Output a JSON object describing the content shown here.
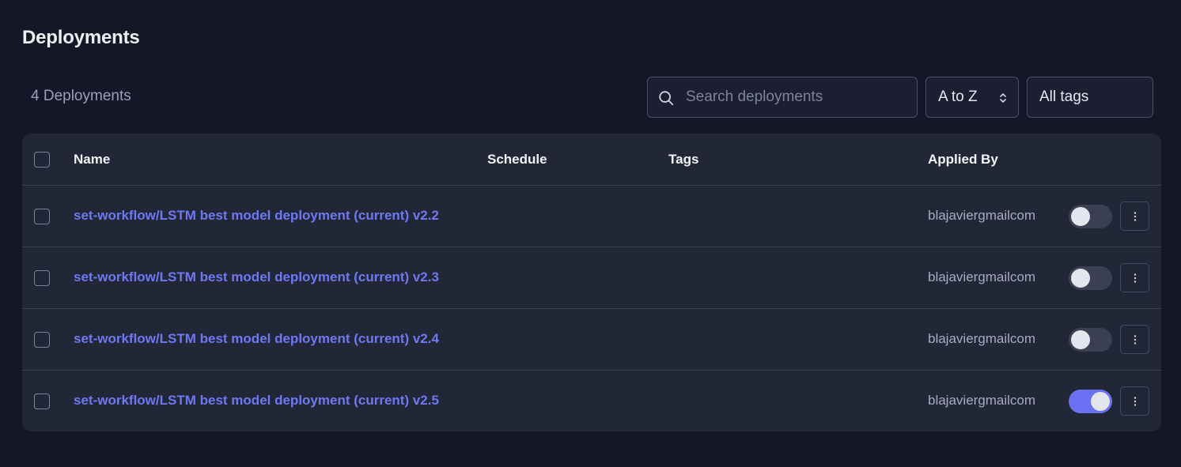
{
  "page": {
    "title": "Deployments",
    "count_label": "4 Deployments"
  },
  "toolbar": {
    "search_placeholder": "Search deployments",
    "sort_label": "A to Z",
    "tags_label": "All tags"
  },
  "table": {
    "columns": {
      "name": "Name",
      "schedule": "Schedule",
      "tags": "Tags",
      "applied_by": "Applied By"
    },
    "rows": [
      {
        "flow": "set-workflow",
        "sep": "/",
        "deployment": "LSTM best model deployment (current) v2.2",
        "applied_by": "blajaviergmailcom",
        "active": false
      },
      {
        "flow": "set-workflow",
        "sep": "/",
        "deployment": "LSTM best model deployment (current) v2.3",
        "applied_by": "blajaviergmailcom",
        "active": false
      },
      {
        "flow": "set-workflow",
        "sep": "/",
        "deployment": "LSTM best model deployment (current) v2.4",
        "applied_by": "blajaviergmailcom",
        "active": false
      },
      {
        "flow": "set-workflow",
        "sep": "/",
        "deployment": "LSTM best model deployment (current) v2.5",
        "applied_by": "blajaviergmailcom",
        "active": true
      }
    ]
  },
  "icons": {
    "search": "search-icon",
    "sort": "chevron-up-down-icon",
    "row_menu": "more-vertical-icon"
  },
  "colors": {
    "background": "#141728",
    "panel": "#222738",
    "link": "#6f78f0",
    "toggle_on": "#6b72f2",
    "toggle_off": "#3a3f52"
  }
}
